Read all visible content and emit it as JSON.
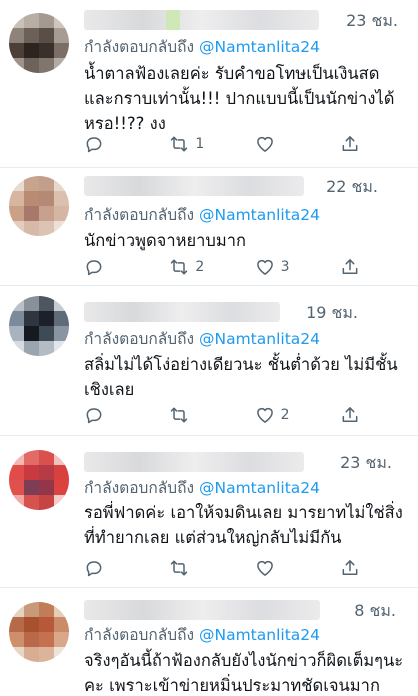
{
  "tweets": [
    {
      "time": "23 ชม.",
      "reply_prefix": "กำลังตอบกลับถึง",
      "reply_handle": "@Namtanlita24",
      "text": "น้ำตาลฟ้องเลยค่ะ รับคำขอโทษเป็นเงินสด และกราบเท่านั้น!!! ปากแบบนี้เป็นนักข่างได้หรอ!!?? งง",
      "replies": "",
      "retweets": "1",
      "likes": "",
      "avatar_colors": [
        "#c9c2b8",
        "#b7aea4",
        "#a49a92",
        "#cfc7bd",
        "#8d837b",
        "#6c6058",
        "#5a4e47",
        "#a69c93",
        "#4b3f38",
        "#2d2420",
        "#3a302b",
        "#7a6e66",
        "#9d938a",
        "#6e635b",
        "#81766e",
        "#b3aaa1"
      ]
    },
    {
      "time": "22 ชม.",
      "reply_prefix": "กำลังตอบกลับถึง",
      "reply_handle": "@Namtanlita24",
      "text": "นักข่าวพูดจาหยาบมาก",
      "replies": "",
      "retweets": "2",
      "likes": "3",
      "avatar_colors": [
        "#e7dbd0",
        "#c7a48e",
        "#c39e8a",
        "#e6d8cc",
        "#d6b6a0",
        "#b98b73",
        "#b58a74",
        "#dbc0ad",
        "#caa187",
        "#a8796a",
        "#c7a08e",
        "#d5b6a5",
        "#e2cdbf",
        "#d6b9a8",
        "#dcc3b3",
        "#ece0d7"
      ]
    },
    {
      "time": "19 ชม.",
      "reply_prefix": "กำลังตอบกลับถึง",
      "reply_handle": "@Namtanlita24",
      "text": "สลิ่มไม่ได้โง่อย่างเดียวนะ ชั้นต่ำด้วย ไม่มีชั้นเชิงเลย",
      "replies": "",
      "retweets": "",
      "likes": "2",
      "avatar_colors": [
        "#b9c0c9",
        "#8a9098",
        "#4e5660",
        "#c6ccd3",
        "#7c8b9c",
        "#2f3640",
        "#1c2028",
        "#5f6b78",
        "#a9b3be",
        "#151a21",
        "#3f4a57",
        "#8995a2",
        "#d7dce1",
        "#9aa5b0",
        "#b3bcc5",
        "#e2e6ea"
      ]
    },
    {
      "time": "23 ชม.",
      "reply_prefix": "กำลังตอบกลับถึง",
      "reply_handle": "@Namtanlita24",
      "text": "รอพี่ฟาดค่ะ เอาให้จมดินเลย มารยาทไม่ใช่สิ่งที่ทำยากเลย แต่ส่วนใหญ่กลับไม่มีกัน",
      "replies": "",
      "retweets": "",
      "likes": "",
      "avatar_colors": [
        "#f1b8b6",
        "#e26a67",
        "#d9504e",
        "#f0c2c0",
        "#e14b49",
        "#c93a40",
        "#b53b47",
        "#d9413f",
        "#e0504c",
        "#7c3d55",
        "#93364a",
        "#dc4240",
        "#efa8a4",
        "#d7514d",
        "#c64443",
        "#f3cdca"
      ]
    },
    {
      "time": "8 ชม.",
      "reply_prefix": "กำลังตอบกลับถึง",
      "reply_handle": "@Namtanlita24",
      "text": "จริงๆอันนี้ถ้าฟ้องกลับยังไงนักข่าวก็ผิดเต็มๆนะคะ เพราะเข้าข่ายหมิ่นประมาทชัดเจนมาก",
      "replies": "",
      "retweets": "",
      "likes": "",
      "avatar_colors": [
        "#e5d3c2",
        "#c89a79",
        "#c27d58",
        "#e6cdb8",
        "#b66a4a",
        "#a8512f",
        "#b5593a",
        "#c98b68",
        "#cf8f6c",
        "#b9694a",
        "#c5714f",
        "#d9a88a",
        "#e9d5c5",
        "#d8ad92",
        "#dcb49b",
        "#efe2d6"
      ]
    }
  ],
  "icons": {
    "reply": "reply-icon",
    "retweet": "retweet-icon",
    "like": "heart-icon",
    "share": "share-icon"
  },
  "colors": {
    "handle": "#1d9bf0",
    "muted": "#536471",
    "text": "#0f1419",
    "divider": "#e6ecf0"
  }
}
